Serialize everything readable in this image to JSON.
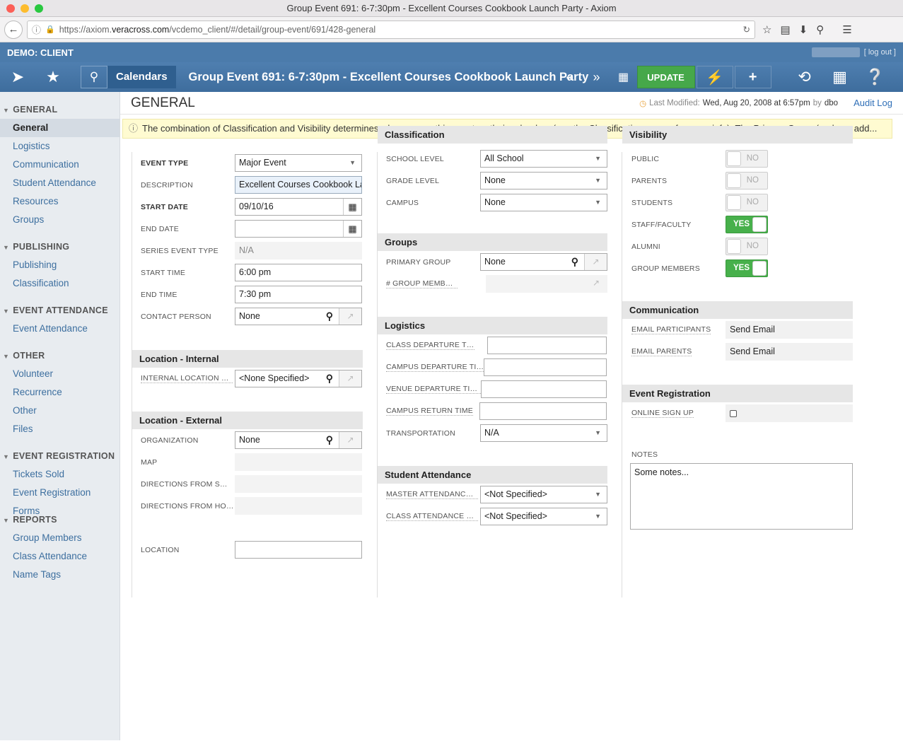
{
  "browser": {
    "window_title": "Group Event 691: 6-7:30pm - Excellent Courses Cookbook Launch Party - Axiom",
    "url_prefix": "https://axiom.",
    "url_host": "veracross.com",
    "url_path": "/vcdemo_client/#/detail/group-event/691/428-general"
  },
  "app": {
    "client": "DEMO: CLIENT",
    "logout": "[ log out ]",
    "breadcrumb": "Calendars",
    "event_title": "Group Event 691: 6-7:30pm - Excellent Courses Cookbook Launch Party",
    "update_label": "UPDATE"
  },
  "sidebar": {
    "general": {
      "heading": "GENERAL",
      "items": [
        "General",
        "Logistics",
        "Communication",
        "Student Attendance",
        "Resources",
        "Groups"
      ]
    },
    "publishing": {
      "heading": "PUBLISHING",
      "items": [
        "Publishing",
        "Classification"
      ]
    },
    "event_attendance": {
      "heading": "EVENT ATTENDANCE",
      "items": [
        "Event Attendance"
      ]
    },
    "other": {
      "heading": "OTHER",
      "items": [
        "Volunteer",
        "Recurrence",
        "Other",
        "Files"
      ]
    },
    "event_registration": {
      "heading": "EVENT REGISTRATION",
      "items": [
        "Tickets Sold",
        "Event Registration Forms"
      ]
    },
    "reports": {
      "heading": "REPORTS",
      "items": [
        "Group Members",
        "Class Attendance",
        "Name Tags"
      ]
    }
  },
  "header": {
    "title": "GENERAL",
    "last_modified_label": "Last Modified:",
    "last_modified_value": "Wed, Aug 20, 2008 at 6:57pm",
    "by_label": "by",
    "by_user": "dbo",
    "audit_log": "Audit Log"
  },
  "notice": "The combination of Classification and Visibility determines who can see this event on their calendars (see the Classification screen for more info). The Primary Group (and any add...",
  "general": {
    "event_type": {
      "label": "EVENT TYPE",
      "value": "Major Event"
    },
    "description": {
      "label": "DESCRIPTION",
      "value": "Excellent Courses Cookbook Lau"
    },
    "start_date": {
      "label": "START DATE",
      "value": "09/10/16"
    },
    "end_date": {
      "label": "END DATE",
      "value": ""
    },
    "series_event_type": {
      "label": "SERIES EVENT TYPE",
      "value": "N/A"
    },
    "start_time": {
      "label": "START TIME",
      "value": "6:00 pm"
    },
    "end_time": {
      "label": "END TIME",
      "value": "7:30 pm"
    },
    "contact_person": {
      "label": "CONTACT PERSON",
      "value": "None"
    }
  },
  "location_internal": {
    "heading": "Location - Internal",
    "internal_location": {
      "label": "INTERNAL LOCATION RES...",
      "value": "<None Specified>"
    }
  },
  "location_external": {
    "heading": "Location - External",
    "organization": {
      "label": "ORGANIZATION",
      "value": "None"
    },
    "map": {
      "label": "MAP"
    },
    "directions_school": {
      "label": "DIRECTIONS FROM SCHO..."
    },
    "directions_home": {
      "label": "DIRECTIONS FROM HOME"
    },
    "location": {
      "label": "LOCATION",
      "value": ""
    }
  },
  "classification": {
    "heading": "Classification",
    "school_level": {
      "label": "SCHOOL LEVEL",
      "value": "All School"
    },
    "grade_level": {
      "label": "GRADE LEVEL",
      "value": "None"
    },
    "campus": {
      "label": "CAMPUS",
      "value": "None"
    }
  },
  "groups": {
    "heading": "Groups",
    "primary_group": {
      "label": "PRIMARY GROUP",
      "value": "None"
    },
    "group_members": {
      "label": "# GROUP MEMBERS",
      "value": ""
    }
  },
  "logistics": {
    "heading": "Logistics",
    "class_departure": {
      "label": "CLASS DEPARTURE TIME",
      "value": ""
    },
    "campus_departure": {
      "label": "CAMPUS DEPARTURE TIME",
      "value": ""
    },
    "venue_departure": {
      "label": "VENUE DEPARTURE TIME",
      "value": ""
    },
    "campus_return": {
      "label": "CAMPUS RETURN TIME",
      "value": ""
    },
    "transportation": {
      "label": "TRANSPORTATION",
      "value": "N/A"
    }
  },
  "student_attendance": {
    "heading": "Student Attendance",
    "master": {
      "label": "MASTER ATTENDANCE ST...",
      "value": "<Not Specified>"
    },
    "class": {
      "label": "CLASS ATTENDANCE STA...",
      "value": "<Not Specified>"
    }
  },
  "visibility": {
    "heading": "Visibility",
    "public": {
      "label": "PUBLIC",
      "value": "NO"
    },
    "parents": {
      "label": "PARENTS",
      "value": "NO"
    },
    "students": {
      "label": "STUDENTS",
      "value": "NO"
    },
    "staff_faculty": {
      "label": "STAFF/FACULTY",
      "value": "YES"
    },
    "alumni": {
      "label": "ALUMNI",
      "value": "NO"
    },
    "group_members": {
      "label": "GROUP MEMBERS",
      "value": "YES"
    }
  },
  "communication": {
    "heading": "Communication",
    "email_participants": {
      "label": "EMAIL PARTICIPANTS",
      "value": "Send Email"
    },
    "email_parents": {
      "label": "EMAIL PARENTS",
      "value": "Send Email"
    }
  },
  "event_registration": {
    "heading": "Event Registration",
    "online_sign_up": {
      "label": "ONLINE SIGN UP",
      "checked": false
    }
  },
  "notes": {
    "label": "NOTES",
    "value": "Some notes..."
  },
  "colors": {
    "brand": "#4b7bab",
    "update": "#46a84a",
    "link": "#3d6f9f",
    "notice": "#fffbd1"
  }
}
